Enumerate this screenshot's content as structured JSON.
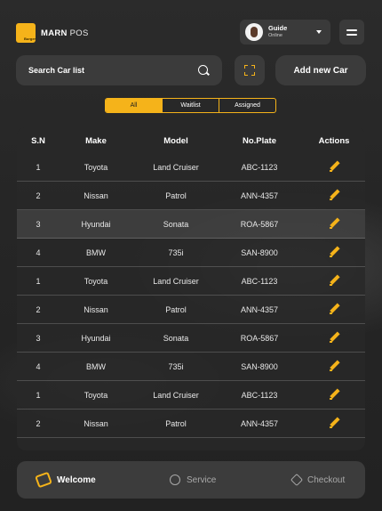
{
  "brand": {
    "name_bold": "MARN",
    "name_rest": " POS",
    "logo_tag": "Burger",
    "logo_color": "#f5b31a"
  },
  "user": {
    "name": "Guide",
    "status": "Online"
  },
  "search": {
    "placeholder": "Search Car list"
  },
  "actions": {
    "add_car_label": "Add new Car"
  },
  "tabs": [
    {
      "label": "All",
      "active": true
    },
    {
      "label": "Waitlist",
      "active": false
    },
    {
      "label": "Assigned",
      "active": false
    }
  ],
  "table": {
    "headers": {
      "sn": "S.N",
      "make": "Make",
      "model": "Model",
      "plate": "No.Plate",
      "actions": "Actions"
    },
    "rows": [
      {
        "sn": "1",
        "make": "Toyota",
        "model": "Land Cruiser",
        "plate": "ABC-1123"
      },
      {
        "sn": "2",
        "make": "Nissan",
        "model": "Patrol",
        "plate": "ANN-4357"
      },
      {
        "sn": "3",
        "make": "Hyundai",
        "model": "Sonata",
        "plate": "ROA-5867"
      },
      {
        "sn": "4",
        "make": "BMW",
        "model": "735i",
        "plate": "SAN-8900"
      },
      {
        "sn": "1",
        "make": "Toyota",
        "model": "Land Cruiser",
        "plate": "ABC-1123"
      },
      {
        "sn": "2",
        "make": "Nissan",
        "model": "Patrol",
        "plate": "ANN-4357"
      },
      {
        "sn": "3",
        "make": "Hyundai",
        "model": "Sonata",
        "plate": "ROA-5867"
      },
      {
        "sn": "4",
        "make": "BMW",
        "model": "735i",
        "plate": "SAN-8900"
      },
      {
        "sn": "1",
        "make": "Toyota",
        "model": "Land Cruiser",
        "plate": "ABC-1123"
      },
      {
        "sn": "2",
        "make": "Nissan",
        "model": "Patrol",
        "plate": "ANN-4357"
      }
    ]
  },
  "bottom_nav": [
    {
      "label": "Welcome",
      "icon": "handshake-icon",
      "active": true
    },
    {
      "label": "Service",
      "icon": "wrench-icon",
      "active": false
    },
    {
      "label": "Checkout",
      "icon": "tag-icon",
      "active": false
    }
  ],
  "colors": {
    "accent": "#f5b31a",
    "panel": "#3b3b3b",
    "background": "#262626"
  }
}
